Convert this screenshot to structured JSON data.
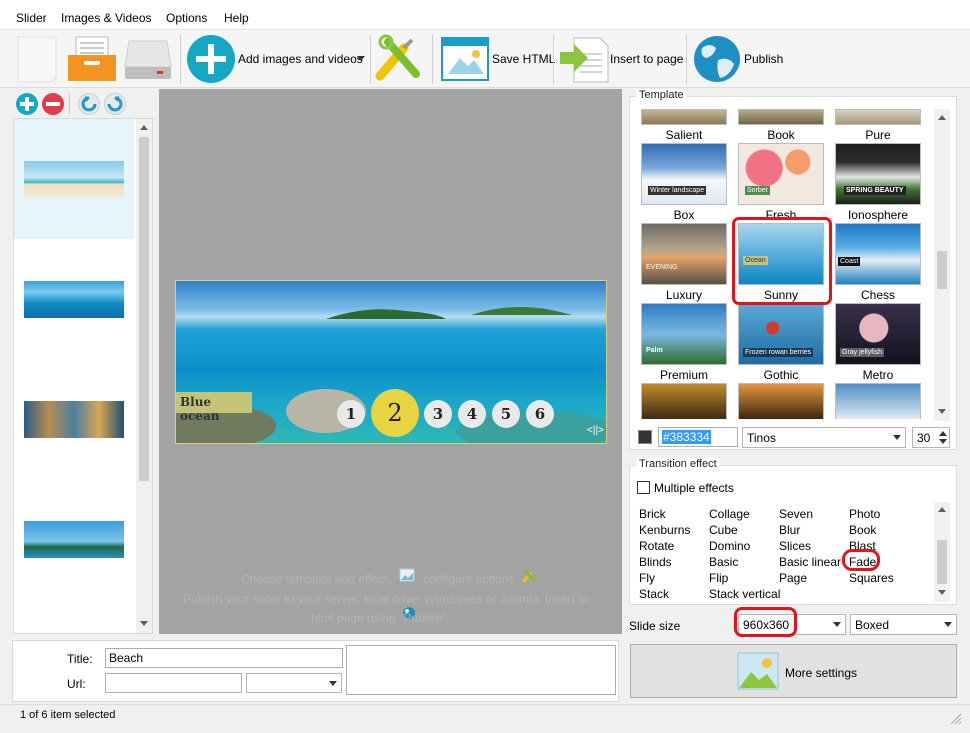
{
  "menu": [
    "Slider",
    "Images & Videos",
    "Options",
    "Help"
  ],
  "toolbar": {
    "add_label": "Add images and videos",
    "save_label": "Save HTML",
    "insert_label": "Insert to page",
    "publish_label": "Publish"
  },
  "preview": {
    "caption": "Blue ocean",
    "bullets": [
      "1",
      "2",
      "3",
      "4",
      "5",
      "6"
    ],
    "active_bullet": "2",
    "hint_line1a": "Choose template and effect,",
    "hint_line1b": "configure options",
    "hint_line2": "Publish your slider to your server, local drive, Wordpress or Joomla. Insert to",
    "hint_line3": "html page using \"Publish\"",
    "nav": "<||>"
  },
  "template": {
    "title": "Template",
    "rows": [
      [
        "Salient",
        "Book",
        "Pure"
      ],
      [
        "Box",
        "Fresh",
        "Ionosphere"
      ],
      [
        "Luxury",
        "Sunny",
        "Chess"
      ],
      [
        "Premium",
        "Gothic",
        "Metro"
      ]
    ],
    "thumb_captions": {
      "box": "Winter landscape",
      "fresh": "Sorbet",
      "ionosphere": "SPRING BEAUTY",
      "luxury": "EVENING",
      "sunny": "Ocean",
      "chess": "Coast",
      "premium": "Palm",
      "gothic": "Frozen rowan berries",
      "metro": "Gray jellyfish"
    },
    "selected": "Sunny",
    "color": "#383334",
    "font": "Tinos",
    "font_size": "30"
  },
  "transition": {
    "title": "Transition effect",
    "multiple_label": "Multiple effects",
    "columns": [
      [
        "Brick",
        "Kenburns",
        "Rotate",
        "Blinds",
        "Fly",
        "Stack"
      ],
      [
        "Collage",
        "Cube",
        "Domino",
        "Basic",
        "Flip",
        "Stack vertical"
      ],
      [
        "Seven",
        "Blur",
        "Slices",
        "Basic linear",
        "Page"
      ],
      [
        "Photo",
        "Book",
        "Blast",
        "Fade",
        "Squares"
      ]
    ],
    "selected": "Fade"
  },
  "slide_size": {
    "label": "Slide size",
    "value": "960x360",
    "mode": "Boxed"
  },
  "more_settings_label": "More settings",
  "fields": {
    "title_label": "Title:",
    "title_value": "Beach",
    "url_label": "Url:",
    "url_value": ""
  },
  "status": "1 of 6 item selected",
  "colors": {
    "accent_red": "#e0151b",
    "bullet_active": "#e8d341",
    "preview_bg": "#a3a3a3"
  }
}
